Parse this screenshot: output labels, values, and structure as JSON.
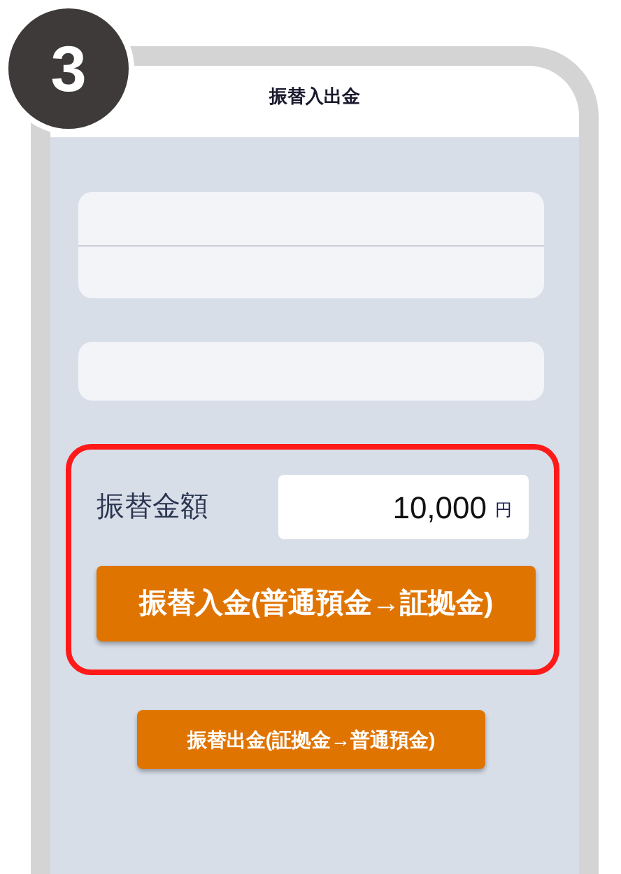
{
  "step_badge": "3",
  "screen": {
    "title": "振替入出金"
  },
  "amount_section": {
    "highlighted": true,
    "label": "振替金額",
    "value": "10,000",
    "unit": "円"
  },
  "buttons": [
    {
      "label": "振替入金(普通預金→証拠金)",
      "kind": "primary"
    },
    {
      "label": "振替出金(証拠金→普通預金)",
      "kind": "secondary"
    }
  ]
}
